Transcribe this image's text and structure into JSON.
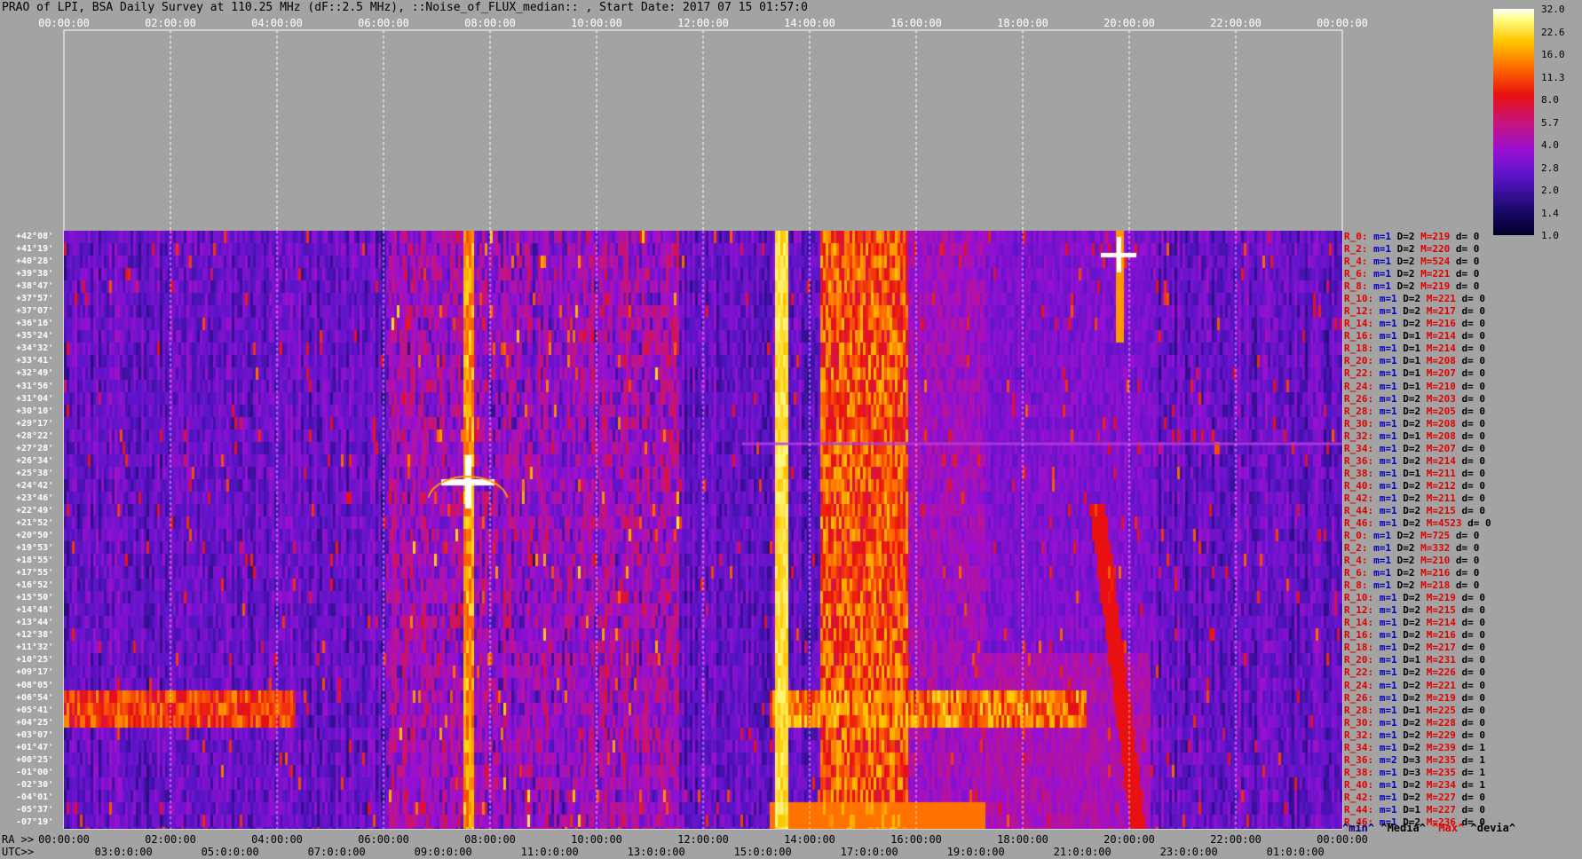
{
  "title": "PRAO of LPI, BSA Daily Survey at 110.25 MHz (dF::2.5 MHz), ::Noise_of_FLUX_median:: , Start Date: 2017 07 15 01:57:0",
  "chart_data": {
    "type": "heatmap",
    "title": "PRAO of LPI, BSA Daily Survey at 110.25 MHz (dF::2.5 MHz), ::Noise_of_FLUX_median:: , Start Date: 2017 07 15 01:57:0",
    "top_axis_ticks": [
      "00:00:00",
      "02:00:00",
      "04:00:00",
      "06:00:00",
      "08:00:00",
      "10:00:00",
      "12:00:00",
      "14:00:00",
      "16:00:00",
      "18:00:00",
      "20:00:00",
      "22:00:00",
      "00:00:00"
    ],
    "ra_label": "RA >>",
    "ra_ticks": [
      "00:00:00",
      "02:00:00",
      "04:00:00",
      "06:00:00",
      "08:00:00",
      "10:00:00",
      "12:00:00",
      "14:00:00",
      "16:00:00",
      "18:00:00",
      "20:00:00",
      "22:00:00",
      "00:00:00"
    ],
    "utc_label": "UTC>>",
    "utc_ticks": [
      "03:0:0:00",
      "05:0:0:00",
      "07:0:0:00",
      "09:0:0:00",
      "11:0:0:00",
      "13:0:0:00",
      "15:0:0:00",
      "17:0:0:00",
      "19:0:0:00",
      "21:0:0:00",
      "23:0:0:00",
      "01:0:0:00"
    ],
    "declinations": [
      "+42°08'",
      "+41°19'",
      "+40°28'",
      "+39°38'",
      "+38°47'",
      "+37°57'",
      "+37°07'",
      "+36°16'",
      "+35°24'",
      "+34°32'",
      "+33°41'",
      "+32°49'",
      "+31°56'",
      "+31°04'",
      "+30°10'",
      "+29°17'",
      "+28°22'",
      "+27°28'",
      "+26°34'",
      "+25°38'",
      "+24°42'",
      "+23°46'",
      "+22°49'",
      "+21°52'",
      "+20°50'",
      "+19°53'",
      "+18°55'",
      "+17°55'",
      "+16°52'",
      "+15°50'",
      "+14°48'",
      "+13°44'",
      "+12°38'",
      "+11°32'",
      "+10°25'",
      "+09°17'",
      "+08°05'",
      "+06°54'",
      "+05°41'",
      "+04°25'",
      "+03°07'",
      "+01°47'",
      "+00°25'",
      "-01°00'",
      "-02°30'",
      "-04°01'",
      "-05°37'",
      "-07°19'"
    ],
    "colorbar": [
      "32.0",
      "22.6",
      "16.0",
      "11.3",
      "8.0",
      "5.7",
      "4.0",
      "2.8",
      "2.0",
      "1.4",
      "1.0"
    ],
    "side_rows": [
      [
        "R_0:",
        "m=1",
        "D=2",
        "M=219",
        "d= 0"
      ],
      [
        "R_2:",
        "m=1",
        "D=2",
        "M=220",
        "d= 0"
      ],
      [
        "R_4:",
        "m=1",
        "D=2",
        "M=524",
        "d= 0"
      ],
      [
        "R_6:",
        "m=1",
        "D=2",
        "M=221",
        "d= 0"
      ],
      [
        "R_8:",
        "m=1",
        "D=2",
        "M=219",
        "d= 0"
      ],
      [
        "R_10:",
        "m=1",
        "D=2",
        "M=221",
        "d= 0"
      ],
      [
        "R_12:",
        "m=1",
        "D=2",
        "M=217",
        "d= 0"
      ],
      [
        "R_14:",
        "m=1",
        "D=2",
        "M=216",
        "d= 0"
      ],
      [
        "R_16:",
        "m=1",
        "D=1",
        "M=214",
        "d= 0"
      ],
      [
        "R_18:",
        "m=1",
        "D=1",
        "M=214",
        "d= 0"
      ],
      [
        "R_20:",
        "m=1",
        "D=1",
        "M=208",
        "d= 0"
      ],
      [
        "R_22:",
        "m=1",
        "D=1",
        "M=207",
        "d= 0"
      ],
      [
        "R_24:",
        "m=1",
        "D=1",
        "M=210",
        "d= 0"
      ],
      [
        "R_26:",
        "m=1",
        "D=2",
        "M=203",
        "d= 0"
      ],
      [
        "R_28:",
        "m=1",
        "D=2",
        "M=205",
        "d= 0"
      ],
      [
        "R_30:",
        "m=1",
        "D=2",
        "M=208",
        "d= 0"
      ],
      [
        "R_32:",
        "m=1",
        "D=1",
        "M=208",
        "d= 0"
      ],
      [
        "R_34:",
        "m=1",
        "D=2",
        "M=207",
        "d= 0"
      ],
      [
        "R_36:",
        "m=1",
        "D=2",
        "M=214",
        "d= 0"
      ],
      [
        "R_38:",
        "m=1",
        "D=1",
        "M=211",
        "d= 0"
      ],
      [
        "R_40:",
        "m=1",
        "D=2",
        "M=212",
        "d= 0"
      ],
      [
        "R_42:",
        "m=1",
        "D=2",
        "M=211",
        "d= 0"
      ],
      [
        "R_44:",
        "m=1",
        "D=2",
        "M=215",
        "d= 0"
      ],
      [
        "R_46:",
        "m=1",
        "D=2",
        "M=4523",
        "d= 0"
      ],
      [
        "R_0:",
        "m=1",
        "D=2",
        "M=725",
        "d= 0"
      ],
      [
        "R_2:",
        "m=1",
        "D=2",
        "M=332",
        "d= 0"
      ],
      [
        "R_4:",
        "m=1",
        "D=2",
        "M=210",
        "d= 0"
      ],
      [
        "R_6:",
        "m=1",
        "D=2",
        "M=216",
        "d= 0"
      ],
      [
        "R_8:",
        "m=1",
        "D=2",
        "M=218",
        "d= 0"
      ],
      [
        "R_10:",
        "m=1",
        "D=2",
        "M=219",
        "d= 0"
      ],
      [
        "R_12:",
        "m=1",
        "D=2",
        "M=215",
        "d= 0"
      ],
      [
        "R_14:",
        "m=1",
        "D=2",
        "M=214",
        "d= 0"
      ],
      [
        "R_16:",
        "m=1",
        "D=2",
        "M=216",
        "d= 0"
      ],
      [
        "R_18:",
        "m=1",
        "D=2",
        "M=217",
        "d= 0"
      ],
      [
        "R_20:",
        "m=1",
        "D=1",
        "M=231",
        "d= 0"
      ],
      [
        "R_22:",
        "m=1",
        "D=2",
        "M=226",
        "d= 0"
      ],
      [
        "R_24:",
        "m=1",
        "D=2",
        "M=221",
        "d= 0"
      ],
      [
        "R_26:",
        "m=1",
        "D=2",
        "M=219",
        "d= 0"
      ],
      [
        "R_28:",
        "m=1",
        "D=1",
        "M=225",
        "d= 0"
      ],
      [
        "R_30:",
        "m=1",
        "D=2",
        "M=228",
        "d= 0"
      ],
      [
        "R_32:",
        "m=1",
        "D=2",
        "M=229",
        "d= 0"
      ],
      [
        "R_34:",
        "m=1",
        "D=2",
        "M=239",
        "d= 1"
      ],
      [
        "R_36:",
        "m=2",
        "D=3",
        "M=235",
        "d= 1"
      ],
      [
        "R_38:",
        "m=1",
        "D=3",
        "M=235",
        "d= 1"
      ],
      [
        "R_40:",
        "m=1",
        "D=2",
        "M=234",
        "d= 1"
      ],
      [
        "R_42:",
        "m=1",
        "D=2",
        "M=227",
        "d= 0"
      ],
      [
        "R_44:",
        "m=1",
        "D=1",
        "M=227",
        "d= 0"
      ],
      [
        "R_46:",
        "m=1",
        "D=2",
        "M=236",
        "d= 0"
      ]
    ],
    "legend": [
      "^min^",
      "^Media^",
      "^Max^",
      "^devia^"
    ]
  }
}
